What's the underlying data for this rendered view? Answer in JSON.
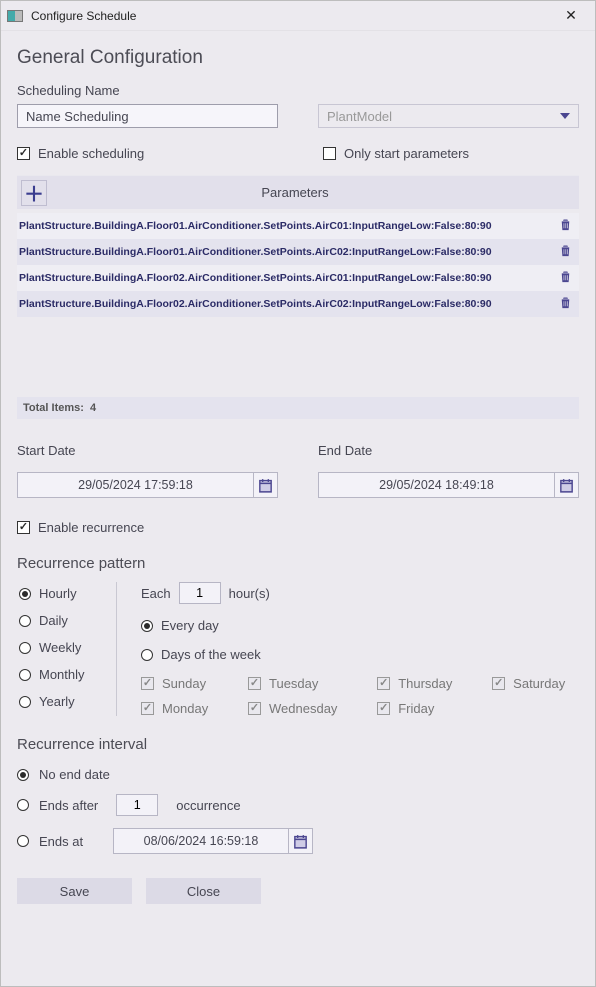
{
  "window": {
    "title": "Configure Schedule"
  },
  "header": {
    "title": "General Configuration"
  },
  "fields": {
    "scheduling_name_label": "Scheduling Name",
    "scheduling_name_value": "Name Scheduling",
    "plantmodel_placeholder": "PlantModel"
  },
  "checks": {
    "enable_scheduling": "Enable scheduling",
    "only_start_parameters": "Only start parameters"
  },
  "params": {
    "header": "Parameters",
    "rows": [
      "PlantStructure.BuildingA.Floor01.AirConditioner.SetPoints.AirC01:InputRangeLow:False:80:90",
      "PlantStructure.BuildingA.Floor01.AirConditioner.SetPoints.AirC02:InputRangeLow:False:80:90",
      "PlantStructure.BuildingA.Floor02.AirConditioner.SetPoints.AirC01:InputRangeLow:False:80:90",
      "PlantStructure.BuildingA.Floor02.AirConditioner.SetPoints.AirC02:InputRangeLow:False:80:90"
    ],
    "total_label": "Total Items:",
    "total_value": "4"
  },
  "dates": {
    "start_label": "Start Date",
    "start_value": "29/05/2024 17:59:18",
    "end_label": "End Date",
    "end_value": "29/05/2024 18:49:18"
  },
  "recurrence": {
    "enable_label": "Enable recurrence",
    "pattern_header": "Recurrence pattern",
    "freq": {
      "hourly": "Hourly",
      "daily": "Daily",
      "weekly": "Weekly",
      "monthly": "Monthly",
      "yearly": "Yearly"
    },
    "each_label": "Each",
    "each_value": "1",
    "each_unit": "hour(s)",
    "every_day": "Every day",
    "days_of_week": "Days of the week",
    "days": {
      "sunday": "Sunday",
      "monday": "Monday",
      "tuesday": "Tuesday",
      "wednesday": "Wednesday",
      "thursday": "Thursday",
      "friday": "Friday",
      "saturday": "Saturday"
    }
  },
  "interval": {
    "header": "Recurrence interval",
    "no_end": "No end date",
    "ends_after": "Ends after",
    "ends_after_value": "1",
    "occurrence": "occurrence",
    "ends_at": "Ends at",
    "ends_at_value": "08/06/2024 16:59:18"
  },
  "buttons": {
    "save": "Save",
    "close": "Close"
  }
}
